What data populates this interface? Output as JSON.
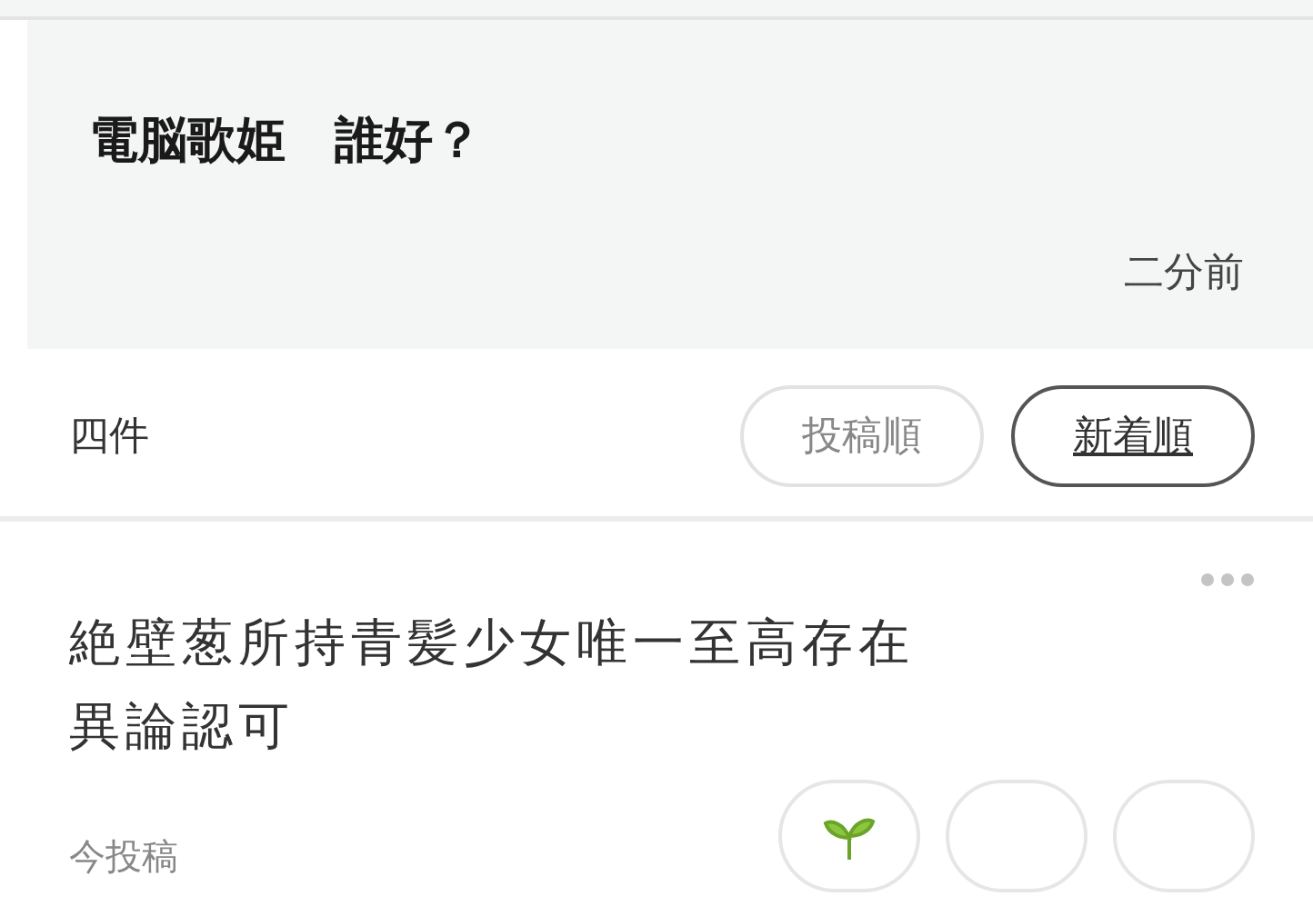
{
  "question": {
    "title": "電脳歌姫　誰好？",
    "time": "二分前"
  },
  "answers_header": {
    "count": "四件",
    "sort_options": [
      {
        "label": "投稿順",
        "selected": false
      },
      {
        "label": "新着順",
        "selected": true
      }
    ]
  },
  "answers": [
    {
      "text": "絶壁葱所持青髪少女唯一至高存在異論認可",
      "time": "今投稿"
    }
  ]
}
